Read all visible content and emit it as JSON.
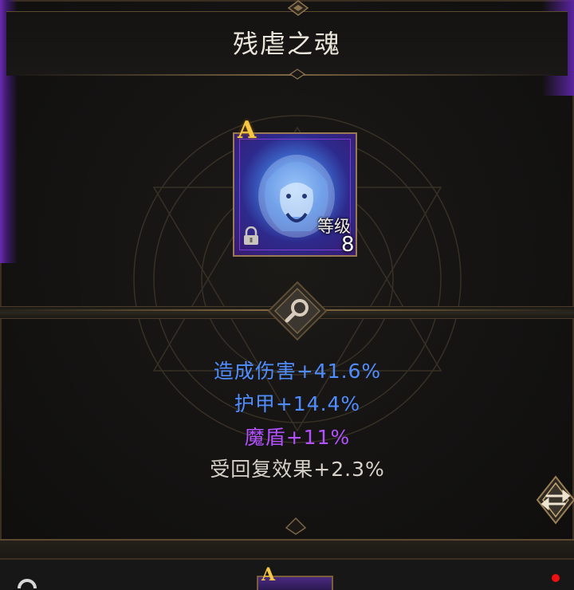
{
  "panel": {
    "title": "残虐之魂"
  },
  "item": {
    "grade": "A",
    "level_label": "等级",
    "level": "8",
    "locked": true,
    "icon": "lion-beast-portrait"
  },
  "stats": [
    {
      "text": "造成伤害+41.6%",
      "color": "#4f8dff"
    },
    {
      "text": "护甲+14.4%",
      "color": "#4f8dff"
    },
    {
      "text": "魔盾+11%",
      "color": "#b251ff"
    },
    {
      "text": "受回复效果+2.3%",
      "color": "#d6d2ca"
    }
  ],
  "controls": {
    "search_icon": "magnifier-icon",
    "swap_icon": "swap-arrows-icon"
  },
  "bottom_strip": {
    "item_grade": "A"
  }
}
